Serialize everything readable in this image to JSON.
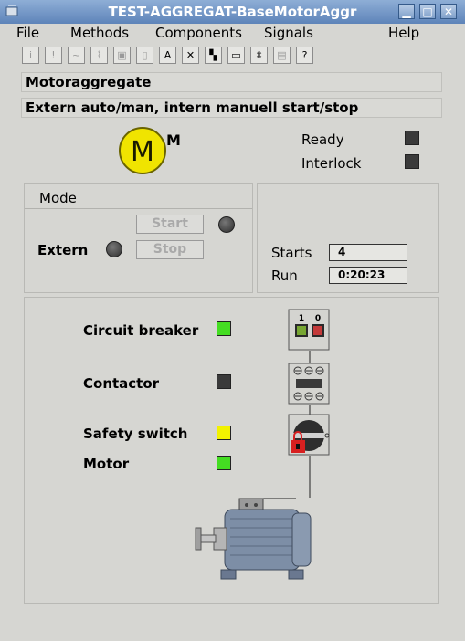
{
  "window": {
    "title": "TEST-AGGREGAT-BaseMotorAggr"
  },
  "menu": [
    "File",
    "Methods",
    "Components",
    "Signals",
    "Help"
  ],
  "toolbar": {
    "count": 14
  },
  "header": {
    "title": "Motoraggregate",
    "description": "Extern auto/man, intern manuell start/stop"
  },
  "logo": {
    "letter": "M",
    "superscript": "M"
  },
  "status": {
    "ready_label": "Ready",
    "interlock_label": "Interlock"
  },
  "mode": {
    "title": "Mode",
    "extern_label": "Extern",
    "start_label": "Start",
    "stop_label": "Stop"
  },
  "counters": {
    "starts_label": "Starts",
    "starts_value": "4",
    "run_label": "Run",
    "run_value": "0:20:23"
  },
  "components": {
    "circuit_breaker": {
      "label": "Circuit breaker",
      "color": "#44dd22"
    },
    "contactor": {
      "label": "Contactor",
      "color": "#3a3a3a"
    },
    "safety_switch": {
      "label": "Safety switch",
      "color": "#f2f200"
    },
    "motor": {
      "label": "Motor",
      "color": "#44dd22"
    },
    "breaker_on": "1",
    "breaker_off": "0"
  },
  "colors": {
    "indicator_off": "#3a3a3a",
    "logo_yellow": "#f0e400"
  }
}
